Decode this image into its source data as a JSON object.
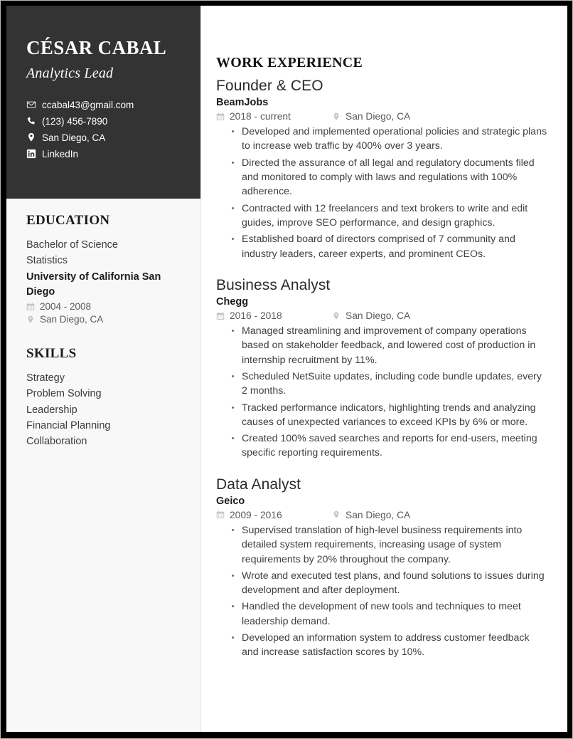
{
  "header": {
    "name": "CÉSAR CABAL",
    "title": "Analytics Lead",
    "contacts": [
      {
        "icon": "envelope-icon",
        "value": "ccabal43@gmail.com"
      },
      {
        "icon": "phone-icon",
        "value": "(123) 456-7890"
      },
      {
        "icon": "map-pin-icon",
        "value": "San Diego, CA"
      },
      {
        "icon": "linkedin-icon",
        "value": "LinkedIn"
      }
    ]
  },
  "sidebar": {
    "education": {
      "heading": "EDUCATION",
      "degree": "Bachelor of Science",
      "field": "Statistics",
      "school": "University of California San Diego",
      "dates": "2004 - 2008",
      "location": "San Diego, CA"
    },
    "skills": {
      "heading": "SKILLS",
      "items": [
        "Strategy",
        "Problem Solving",
        "Leadership",
        "Financial Planning",
        "Collaboration"
      ]
    }
  },
  "main": {
    "heading": "WORK EXPERIENCE",
    "jobs": [
      {
        "title": "Founder & CEO",
        "company": "BeamJobs",
        "dates": "2018 - current",
        "location": "San Diego, CA",
        "bullets": [
          "Developed and implemented operational policies and strategic plans to increase web traffic by 400% over 3 years.",
          "Directed the assurance of all legal and regulatory documents filed and monitored to comply with laws and regulations with 100% adherence.",
          "Contracted with 12 freelancers and text brokers to write and edit guides, improve SEO performance, and design graphics.",
          "Established board of directors comprised of 7 community and industry leaders, career experts, and prominent CEOs."
        ]
      },
      {
        "title": "Business Analyst",
        "company": "Chegg",
        "dates": "2016 - 2018",
        "location": "San Diego, CA",
        "bullets": [
          "Managed streamlining and improvement of company operations based on stakeholder feedback, and lowered cost of production in internship recruitment by 11%.",
          "Scheduled NetSuite updates, including code bundle updates, every 2 months.",
          "Tracked performance indicators, highlighting trends and analyzing causes of unexpected variances to exceed KPIs by 6% or more.",
          "Created 100% saved searches and reports for end-users, meeting specific reporting requirements."
        ]
      },
      {
        "title": "Data Analyst",
        "company": "Geico",
        "dates": "2009 - 2016",
        "location": "San Diego, CA",
        "bullets": [
          "Supervised translation of high-level business requirements into detailed system requirements, increasing usage of system requirements by 20% throughout the company.",
          "Wrote and executed test plans, and found solutions to issues during development and after deployment.",
          "Handled the development of new tools and techniques to meet leadership demand.",
          "Developed an information system to address customer feedback and increase satisfaction scores by 10%."
        ]
      }
    ]
  },
  "colors": {
    "id_block_bg": "#333333",
    "sidebar_bg": "#f8f8f9",
    "frame": "#000000",
    "heading_text": "#121212",
    "body_text": "#3f3f3f",
    "meta_text": "#5a5a5a"
  }
}
